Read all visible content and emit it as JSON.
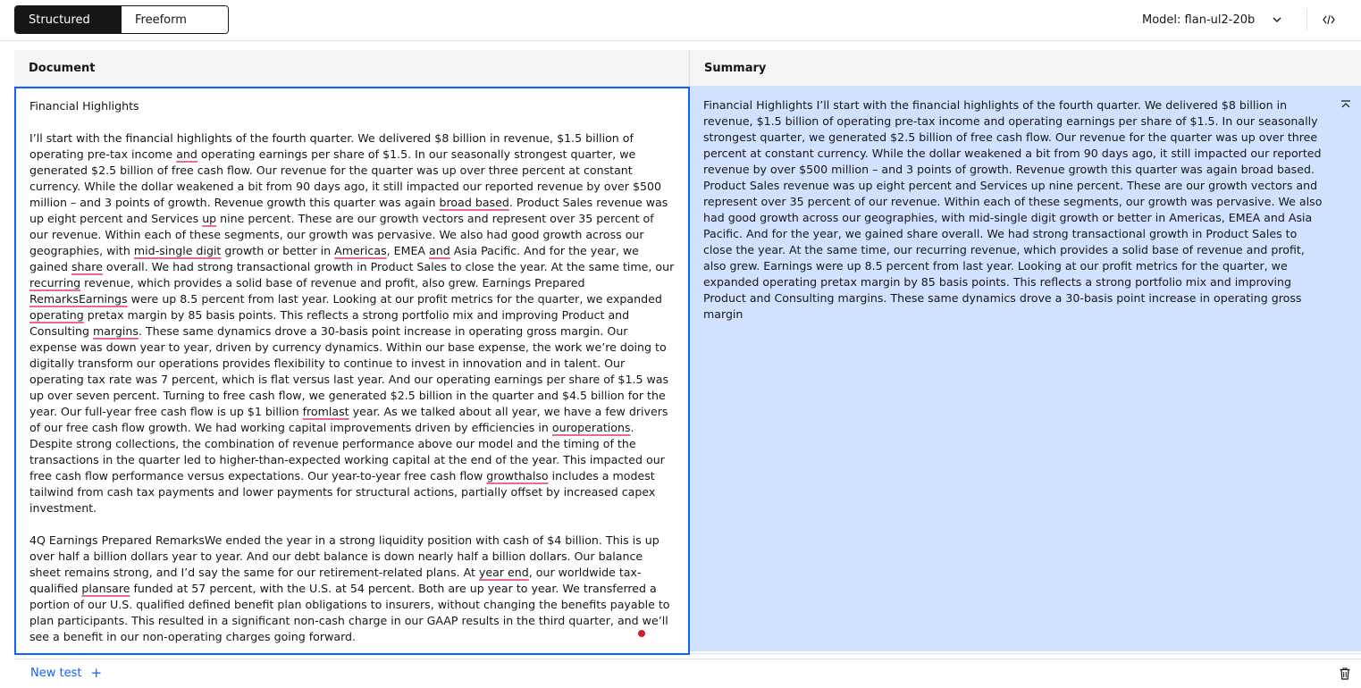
{
  "topbar": {
    "modes": [
      {
        "label": "Structured",
        "active": true
      },
      {
        "label": "Freeform",
        "active": false
      }
    ],
    "model_label": "Model: flan-ul2-20b",
    "icons": {
      "model_dropdown": "chevron-down-icon",
      "code_view": "code-icon"
    }
  },
  "document": {
    "header": "Document",
    "title": "Financial Highlights",
    "para1": [
      "I’ll start with the financial highlights of the fourth quarter. We delivered $8 billion in revenue, $1.5 billion of operating pre-tax income ",
      "and",
      " operating earnings per share of $1.5. In our seasonally strongest quarter, we generated $2.5 billion of free cash flow. Our revenue for the quarter was up over three percent at constant currency. While the dollar weakened a bit from 90 days ago, it still impacted our reported revenue by over $500 million – and 3 points of growth.  Revenue growth this quarter was again ",
      "broad based",
      ". Product Sales revenue was up eight percent and Services ",
      "up",
      " nine percent. These are our growth vectors and represent over 35 percent of our revenue. Within each of these segments, our growth was pervasive. We also had good growth across our geographies, with ",
      "mid-single digit",
      " growth or better in ",
      "Americas",
      ", EMEA ",
      "and",
      " Asia Pacific. And for the year, we gained ",
      "share",
      " overall. We had strong transactional growth in Product Sales to close the year. At the same time, our ",
      "recurring",
      " revenue, which provides a solid base of revenue and profit, also grew. Earnings Prepared ",
      "RemarksEarnings",
      " were up 8.5 percent from last year. Looking at our profit metrics for the quarter, we expanded ",
      "operating",
      " pretax margin by 85 basis points. This reflects a strong portfolio mix and improving Product and Consulting ",
      "margins",
      ". These same dynamics drove a 30-basis point increase in operating gross margin. Our expense was down year to year, driven by currency dynamics. Within our base expense, the work we’re doing to digitally transform our operations provides flexibility to continue to invest in innovation and in talent. Our operating tax rate was 7 percent, which is flat versus last year. And our operating earnings per share of $1.5 was up over seven percent. Turning to free cash flow, we generated $2.5 billion in the quarter and $4.5 billion for the year. Our full-year free cash flow is up $1 billion ",
      "fromlast",
      " year. As we talked about all year, we have a few drivers of our free cash flow growth. We had working capital improvements driven by efficiencies in ",
      "ouroperations",
      ". Despite strong collections, the combination of revenue performance above our model and the timing of the transactions in the quarter led to higher-than-expected working capital at the end of the year. This impacted our free cash flow performance versus expectations. Our year-to-year free cash flow ",
      "growthalso",
      " includes a modest tailwind from cash tax payments and lower payments for structural actions, partially offset by increased capex investment."
    ],
    "para2": [
      "4Q Earnings Prepared RemarksWe ended the year in a strong liquidity position with cash of $4 billion. This is up over half a billion dollars year to year. And our debt balance is down nearly half a billion dollars. Our balance sheet remains strong, and I’d say the same for our retirement-related plans. At ",
      "year end",
      ", our worldwide tax-qualified ",
      "plansare",
      " funded at 57 percent, with the U.S. at 54 percent. Both are up year to year. We transferred a portion of our U.S. qualified defined benefit plan obligations to insurers, without changing the benefits payable to plan participants. This resulted in a significant non-cash charge in our GAAP results in the third quarter, and we’ll see a benefit in our non-operating charges going forward."
    ]
  },
  "summary": {
    "header": "Summary",
    "text": "Financial Highlights I’ll start with the financial highlights of the fourth quarter. We delivered $8 billion in revenue, $1.5 billion of operating pre-tax income and operating earnings per share of $1.5. In our seasonally strongest quarter, we generated $2.5 billion of free cash flow. Our revenue for the quarter was up over three percent at constant currency. While the dollar weakened a bit from 90 days ago, it still impacted our reported revenue by over $500 million – and 3 points of growth. Revenue growth this quarter was again broad based. Product Sales revenue was up eight percent and Services up nine percent. These are our growth vectors and represent over 35 percent of our revenue. Within each of these segments, our growth was pervasive. We also had good growth across our geographies, with mid-single digit growth or better in Americas, EMEA and Asia Pacific. And for the year, we gained share overall. We had strong transactional growth in Product Sales to close the year. At the same time, our recurring revenue, which provides a solid base of revenue and profit, also grew. Earnings were up 8.5 percent from last year. Looking at our profit metrics for the quarter, we expanded operating pretax margin by 85 basis points. This reflects a strong portfolio mix and improving Product and Consulting margins. These same dynamics drove a 30-basis point increase in operating gross margin",
    "icons": {
      "collapse": "collapse-up-icon"
    }
  },
  "footer": {
    "new_test_label": "New test",
    "plus_glyph": "+",
    "icons": {
      "delete": "trash-icon"
    }
  },
  "colors": {
    "accent": "#0f62fe",
    "summary_bg": "#d0e2ff",
    "spell_underline": "#e36d8a",
    "dark": "#161616"
  }
}
